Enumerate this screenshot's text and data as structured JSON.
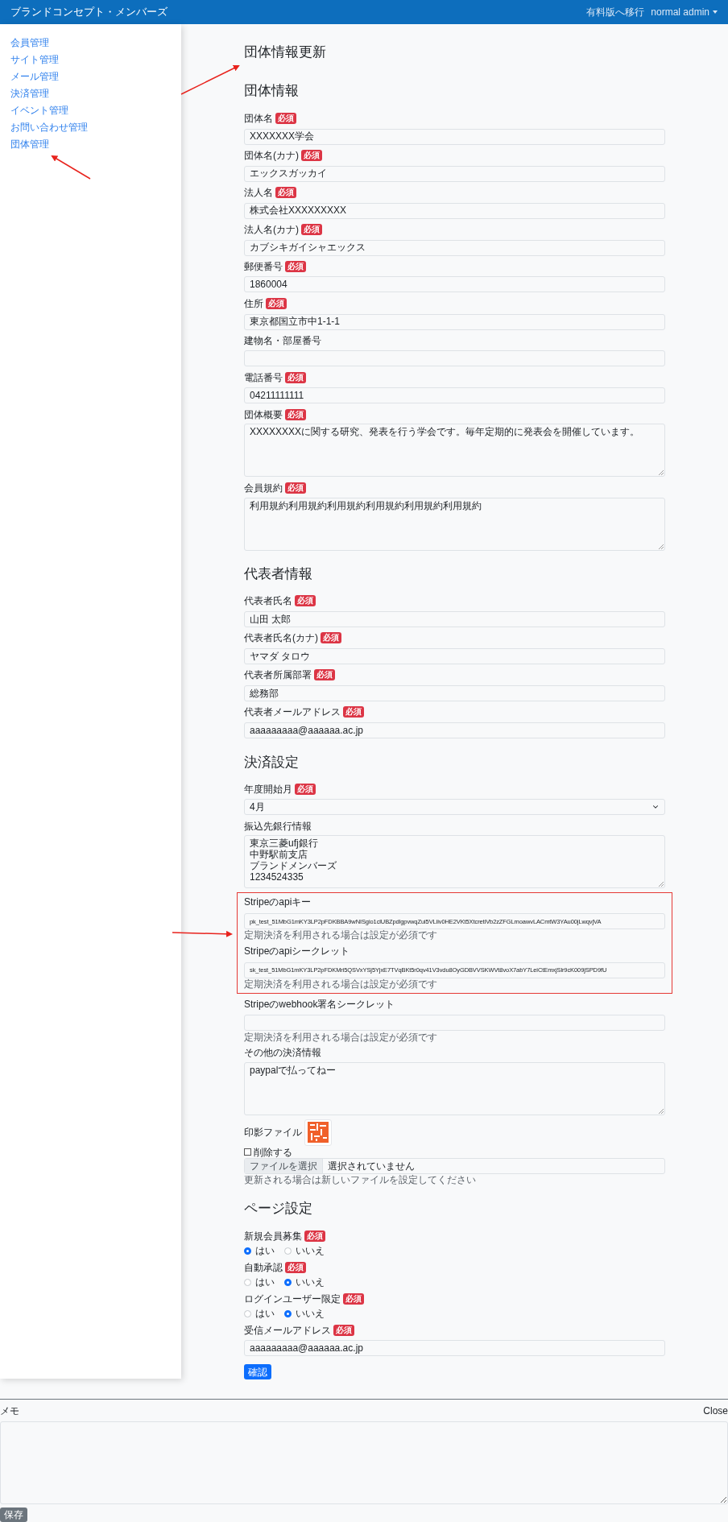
{
  "header": {
    "brand": "ブランドコンセプト・メンバーズ",
    "upgrade_link": "有料版へ移行",
    "user_menu": "normal admin"
  },
  "sidebar": {
    "items": [
      {
        "label": "会員管理"
      },
      {
        "label": "サイト管理"
      },
      {
        "label": "メール管理"
      },
      {
        "label": "決済管理"
      },
      {
        "label": "イベント管理"
      },
      {
        "label": "お問い合わせ管理"
      },
      {
        "label": "団体管理"
      }
    ]
  },
  "page_title": "団体情報更新",
  "sections": [
    {
      "heading": "団体情報",
      "fields": [
        {
          "kind": "text",
          "label": "団体名",
          "badge": "必須",
          "value": "XXXXXXX学会"
        },
        {
          "kind": "text",
          "label": "団体名(カナ)",
          "badge": "必須",
          "value": "エックスガッカイ"
        },
        {
          "kind": "text",
          "label": "法人名",
          "badge": "必須",
          "value": "株式会社XXXXXXXXX"
        },
        {
          "kind": "text",
          "label": "法人名(カナ)",
          "badge": "必須",
          "value": "カブシキガイシャエックス"
        },
        {
          "kind": "text",
          "label": "郵便番号",
          "badge": "必須",
          "value": "1860004"
        },
        {
          "kind": "text",
          "label": "住所",
          "badge": "必須",
          "value": "東京都国立市中1-1-1"
        },
        {
          "kind": "text",
          "label": "建物名・部屋番号"
        },
        {
          "kind": "text",
          "label": "電話番号",
          "badge": "必須",
          "value": "04211111111"
        },
        {
          "kind": "textarea",
          "label": "団体概要",
          "badge": "必須",
          "lines": [
            "XXXXXXXXに関する研究、発表を行う学会です。毎年定期的に発表会を開催しています。"
          ]
        },
        {
          "kind": "textarea",
          "label": "会員規約",
          "badge": "必須",
          "lines": [
            "利用規約利用規約利用規約利用規約利用規約利用規約"
          ]
        }
      ]
    },
    {
      "heading": "代表者情報",
      "fields": [
        {
          "kind": "text",
          "label": "代表者氏名",
          "badge": "必須",
          "value": "山田 太郎"
        },
        {
          "kind": "text",
          "label": "代表者氏名(カナ)",
          "badge": "必須",
          "value": "ヤマダ タロウ"
        },
        {
          "kind": "text",
          "label": "代表者所属部署",
          "badge": "必須",
          "value": "総務部"
        },
        {
          "kind": "text",
          "label": "代表者メールアドレス",
          "badge": "必須",
          "value": "aaaaaaaaa@aaaaaa.ac.jp"
        }
      ]
    },
    {
      "heading": "決済設定",
      "fields": [
        {
          "kind": "select",
          "label": "年度開始月",
          "badge": "必須",
          "value": "4月"
        },
        {
          "kind": "textarea",
          "label": "振込先銀行情報",
          "lines": [
            "東京三菱ufj銀行",
            "中野駅前支店",
            "ブランドメンバーズ",
            "1234524335"
          ]
        },
        {
          "kind": "group",
          "highlighted": true,
          "fields": [
            {
              "kind": "text",
              "label": "Stripeのapiキー",
              "value": "pk_test_51MbG1mKY3LP2pFDKBBA9wNISgio1clUBZpdlgpvwqZui5VLiiv0HE2VKt5XtcretiVb2zZFGLmoawvLACmtW3YAu00jLwqvjVA",
              "help": "定期決済を利用される場合は設定が必須です"
            },
            {
              "kind": "text",
              "label": "Stripeのapiシークレット",
              "value": "sk_test_51MbG1mKY3LP2pFDKMri5QSVxYSj5YjxE7TVqBKt5r0qv41V3vdu8OyGDBVVSKWVt8voX7abY7LeiCtEmxjSlr9cK009jSPD9fU",
              "help": "定期決済を利用される場合は設定が必須です"
            }
          ]
        },
        {
          "kind": "text",
          "label": "Stripeのwebhook署名シークレット",
          "help": "定期決済を利用される場合は設定が必須です"
        },
        {
          "kind": "textarea",
          "label": "その他の決済情報",
          "lines": [
            "paypalで払ってねー"
          ]
        },
        {
          "kind": "file",
          "label": "印影ファイル",
          "delete_checkbox": {
            "label": "削除する",
            "checked": false
          },
          "button": "ファイルを選択",
          "status": "選択されていません",
          "help": "更新される場合は新しいファイルを設定してください"
        }
      ]
    },
    {
      "heading": "ページ設定",
      "fields": [
        {
          "kind": "radio",
          "label": "新規会員募集",
          "badge": "必須",
          "options": [
            {
              "label": "はい",
              "selected": true
            },
            {
              "label": "いいえ",
              "selected": false
            }
          ]
        },
        {
          "kind": "radio",
          "label": "自動承認",
          "badge": "必須",
          "options": [
            {
              "label": "はい",
              "selected": false
            },
            {
              "label": "いいえ",
              "selected": true
            }
          ]
        },
        {
          "kind": "radio",
          "label": "ログインユーザー限定",
          "badge": "必須",
          "options": [
            {
              "label": "はい",
              "selected": false
            },
            {
              "label": "いいえ",
              "selected": true
            }
          ]
        },
        {
          "kind": "text",
          "label": "受信メールアドレス",
          "badge": "必須",
          "value": "aaaaaaaaa@aaaaaa.ac.jp"
        }
      ]
    }
  ],
  "submit_button": "確認",
  "memo": {
    "label": "メモ",
    "close": "Close",
    "save_button": "保存"
  }
}
